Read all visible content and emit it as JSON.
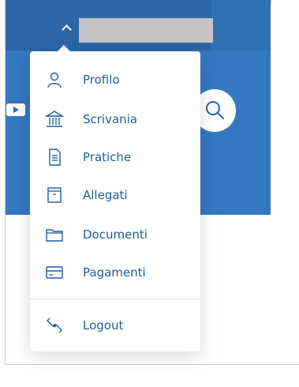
{
  "header": {
    "user_name": "",
    "colors": {
      "topbar": "#2a66a8",
      "header": "#3578c2",
      "menu_text": "#1e5c9e"
    }
  },
  "icons": {
    "play": "play-icon",
    "search": "search-icon"
  },
  "menu": {
    "items": [
      {
        "label": "Profilo",
        "icon": "user-icon"
      },
      {
        "label": "Scrivania",
        "icon": "bank-icon"
      },
      {
        "label": "Pratiche",
        "icon": "file-text-icon"
      },
      {
        "label": "Allegati",
        "icon": "archive-icon"
      },
      {
        "label": "Documenti",
        "icon": "folder-icon"
      },
      {
        "label": "Pagamenti",
        "icon": "credit-card-icon"
      }
    ],
    "logout": {
      "label": "Logout",
      "icon": "link-icon"
    }
  }
}
